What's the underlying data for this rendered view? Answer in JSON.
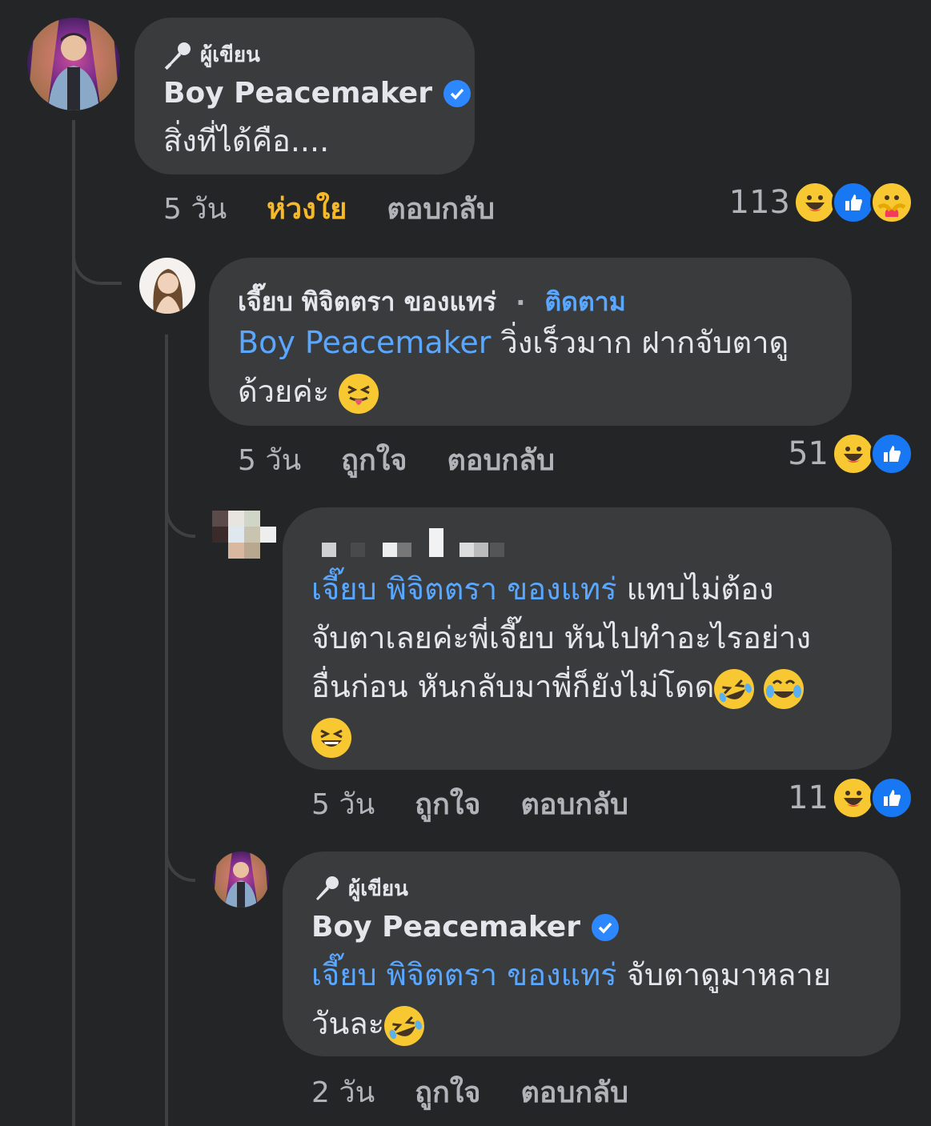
{
  "thread": {
    "comment1": {
      "author_badge": "ผู้เขียน",
      "name": "Boy Peacemaker",
      "text": "สิ่งที่ได้คือ....",
      "time": "5 วัน",
      "reaction_label": "ห่วงใย",
      "reply_label": "ตอบกลับ",
      "reaction_count": "113",
      "reaction_icons": [
        "haha-icon",
        "like-icon",
        "care-icon"
      ]
    },
    "reply1": {
      "name": "เจี๊ยบ พิจิตตรา ของแทร่",
      "follow_label": "ติดตาม",
      "mention": "Boy Peacemaker",
      "text_line1": " วิ่งเร็วมาก ฝากจับตาดู",
      "text_line2": "ด้วยค่ะ",
      "time": "5 วัน",
      "like_label": "ถูกใจ",
      "reply_label": "ตอบกลับ",
      "reaction_count": "51",
      "reaction_icons": [
        "haha-icon",
        "like-icon"
      ]
    },
    "reply2": {
      "mention": "เจี๊ยบ พิจิตตรา ของแทร่",
      "text_line1": " แทบไม่ต้อง",
      "text_line2": "จับตาเลยค่ะพี่เจี๊ยบ  หันไปทำอะไรอย่าง",
      "text_line3": "อื่นก่อน หันกลับมาพี่ก็ยังไม่โดด",
      "time": "5 วัน",
      "like_label": "ถูกใจ",
      "reply_label": "ตอบกลับ",
      "reaction_count": "11",
      "reaction_icons": [
        "haha-icon",
        "like-icon"
      ]
    },
    "reply3": {
      "author_badge": "ผู้เขียน",
      "name": "Boy Peacemaker",
      "mention": "เจี๊ยบ พิจิตตรา ของแทร่",
      "text_line1": " จับตาดูมาหลาย",
      "text_line2": "วันละ",
      "time": "2 วัน",
      "like_label": "ถูกใจ",
      "reply_label": "ตอบกลับ"
    }
  },
  "colors": {
    "background": "#242526",
    "bubble": "#3a3b3c",
    "mention": "#5aa7ff",
    "care_active": "#f7b928",
    "verified": "#2d88ff"
  }
}
